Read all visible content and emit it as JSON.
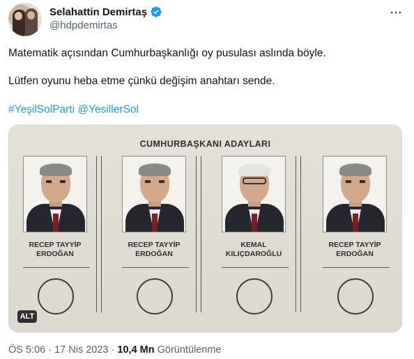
{
  "author": {
    "display_name": "Selahattin Demirtaş",
    "handle": "@hdpdemirtas",
    "verified": true,
    "avatar_icon": "profile-photo"
  },
  "more_icon": "more-horizontal-icon",
  "tweet": {
    "line1": "Matematik açısından Cumhurbaşkanlığı oy pusulası aslında böyle.",
    "line2": "Lütfen oyunu heba etme çünkü değişim anahtarı sende.",
    "hashtags": [
      "#YeşilSolParti",
      "@YesillerSol"
    ]
  },
  "media": {
    "ballot_title": "CUMHURBAŞKANI ADAYLARI",
    "candidates": [
      {
        "name_line1": "RECEP TAYYİP",
        "name_line2": "ERDOĞAN"
      },
      {
        "name_line1": "RECEP TAYYİP",
        "name_line2": "ERDOĞAN"
      },
      {
        "name_line1": "KEMAL",
        "name_line2": "KILIÇDAROĞLU"
      },
      {
        "name_line1": "RECEP TAYYİP",
        "name_line2": "ERDOĞAN"
      }
    ],
    "alt_label": "ALT"
  },
  "meta": {
    "time": "ÖS 5:06",
    "separator": "·",
    "date": "17 Nis 2023",
    "views_count": "10,4 Mn",
    "views_label": "Görüntülenme"
  },
  "colors": {
    "link": "#1d9bf0",
    "text": "#0f1419",
    "secondary": "#536471",
    "verified": "#1d9bf0"
  }
}
